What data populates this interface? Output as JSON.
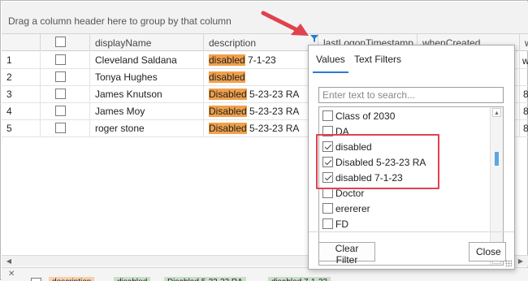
{
  "group_panel": {
    "hint": "Drag a column header here to group by that column"
  },
  "columns": {
    "display_name": "displayName",
    "description": "description",
    "last_logon": "lastLogonTimestamp",
    "when_created": "whenCreated",
    "extra": "w"
  },
  "rows": [
    {
      "num": "1",
      "name": "Cleveland Saldana",
      "desc_hl": "disabled",
      "desc_rest": " 7-1-23",
      "extra": ""
    },
    {
      "num": "2",
      "name": "Tonya Hughes",
      "desc_hl": "disabled",
      "desc_rest": "",
      "extra": ""
    },
    {
      "num": "3",
      "name": "James Knutson",
      "desc_hl": "Disabled",
      "desc_rest": " 5-23-23 RA",
      "extra": "8,"
    },
    {
      "num": "4",
      "name": "James Moy",
      "desc_hl": "Disabled",
      "desc_rest": " 5-23-23 RA",
      "extra": "8,"
    },
    {
      "num": "5",
      "name": "roger stone",
      "desc_hl": "Disabled",
      "desc_rest": " 5-23-23 RA",
      "extra": "8,"
    }
  ],
  "popup": {
    "tab_values": "Values",
    "tab_text_filters": "Text Filters",
    "search_placeholder": "Enter text to search...",
    "items": [
      {
        "label": "Class of 2030",
        "checked": false
      },
      {
        "label": "DA",
        "checked": false
      },
      {
        "label": "disabled",
        "checked": true
      },
      {
        "label": "Disabled 5-23-23 RA",
        "checked": true
      },
      {
        "label": "disabled 7-1-23",
        "checked": true
      },
      {
        "label": "Doctor",
        "checked": false
      },
      {
        "label": "erererer",
        "checked": false
      },
      {
        "label": "FD",
        "checked": false
      }
    ],
    "clear_filter": "Clear Filter",
    "close": "Close"
  },
  "filter_bar": {
    "chips": [
      {
        "label": "description",
        "color": "orange"
      },
      {
        "label": "disabled",
        "color": "green"
      },
      {
        "label": "Disabled 5-23-23 RA",
        "color": "green"
      },
      {
        "label": "disabled 7-1-23",
        "color": "green"
      }
    ]
  },
  "colors": {
    "highlight": "#f0a04b",
    "annotation_red": "#e0424f",
    "tab_accent": "#2b79d1"
  }
}
